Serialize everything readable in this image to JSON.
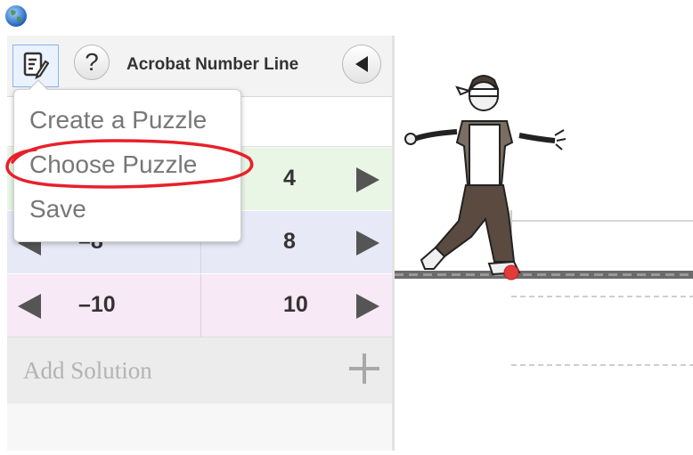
{
  "app": {
    "title": "Acrobat Number Line"
  },
  "toolbar": {
    "edit_icon": "edit-document-icon",
    "help_label": "?",
    "collapse_icon": "triangle-left-icon"
  },
  "menu": {
    "items": [
      {
        "label": "Create a Puzzle"
      },
      {
        "label": "Choose Puzzle"
      },
      {
        "label": "Save"
      }
    ]
  },
  "rows": [
    {
      "left": "",
      "right": "4",
      "color": "#e9f6e6"
    },
    {
      "left": "–8",
      "right": "8",
      "color": "#e8e9f7"
    },
    {
      "left": "–10",
      "right": "10",
      "color": "#f8e9f6"
    }
  ],
  "add_solution": {
    "label": "Add Solution",
    "icon": "plus-icon"
  },
  "annotation_color": "#e8202a"
}
